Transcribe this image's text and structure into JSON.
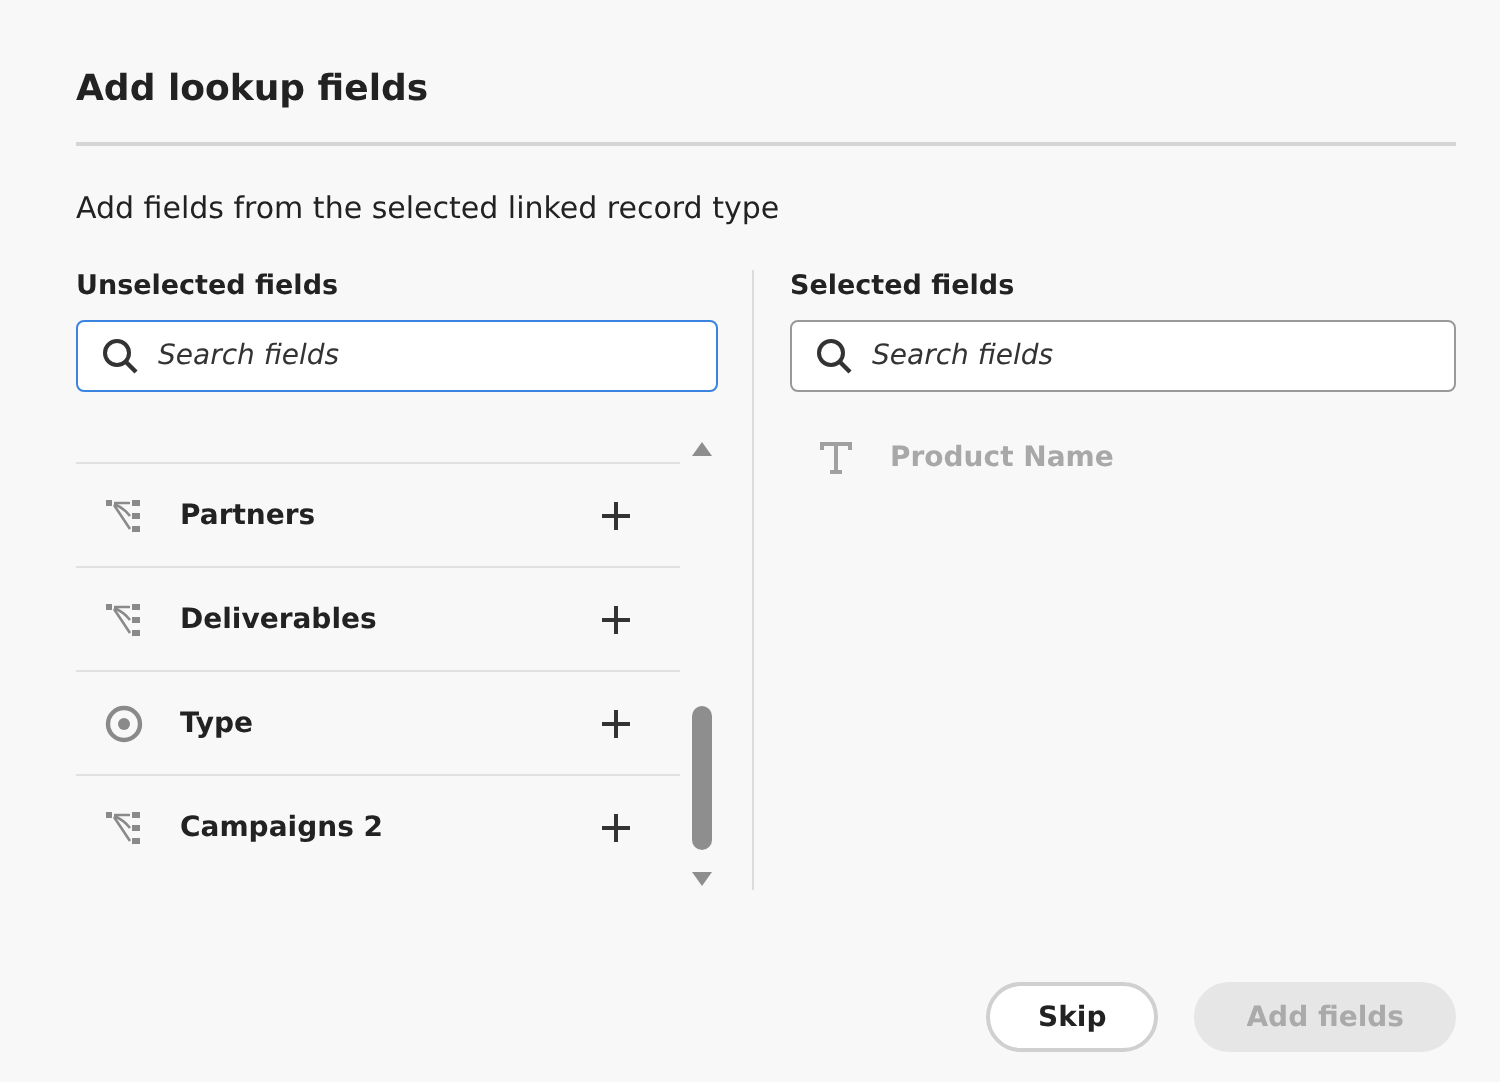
{
  "dialog": {
    "title": "Add lookup fields",
    "description": "Add fields from the selected linked record type"
  },
  "unselected": {
    "heading": "Unselected fields",
    "search": {
      "placeholder": "Search fields",
      "focused": true
    },
    "items": [
      {
        "label": "Partners",
        "kind": "linked"
      },
      {
        "label": "Deliverables",
        "kind": "linked"
      },
      {
        "label": "Type",
        "kind": "select"
      },
      {
        "label": "Campaigns 2",
        "kind": "linked"
      }
    ]
  },
  "selected": {
    "heading": "Selected fields",
    "search": {
      "placeholder": "Search fields",
      "focused": false
    },
    "items": [
      {
        "label": "Product Name",
        "kind": "text",
        "disabled": true
      }
    ]
  },
  "buttons": [
    {
      "label": "Skip",
      "disabled": false
    },
    {
      "label": "Add fields",
      "disabled": true
    }
  ]
}
